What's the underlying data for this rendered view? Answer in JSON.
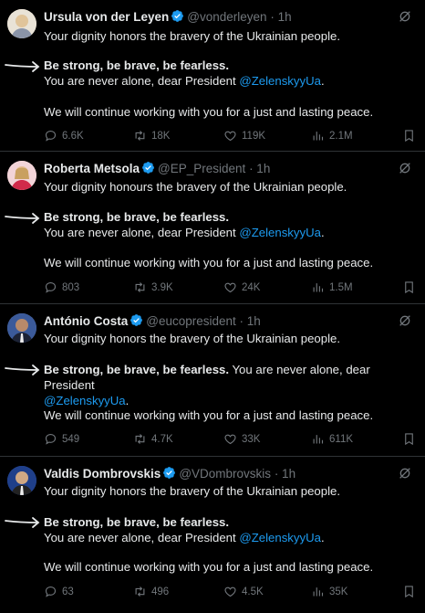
{
  "tweets": [
    {
      "name": "Ursula von der Leyen",
      "handle": "@vonderleyen",
      "time": "· 1h",
      "line1": "Your dignity honors the bravery of the Ukrainian people.",
      "bold": "Be strong, be brave, be fearless.",
      "line3a": "You are never alone, dear President ",
      "mention": "@ZelenskyyUa",
      "line3b": ".",
      "line4": "We will continue working with you for a just and lasting peace.",
      "replies": "6.6K",
      "reposts": "18K",
      "likes": "119K",
      "views": "2.1M",
      "avatar_color": "#c9b8a0"
    },
    {
      "name": "Roberta Metsola",
      "handle": "@EP_President",
      "time": "· 1h",
      "line1": "Your dignity honours the bravery of the Ukrainian people.",
      "bold": "Be strong, be brave, be fearless.",
      "line3a": "You are never alone, dear President ",
      "mention": "@ZelenskyyUa",
      "line3b": ".",
      "line4": "We will continue working with you for a just and lasting peace.",
      "replies": "803",
      "reposts": "3.9K",
      "likes": "24K",
      "views": "1.5M",
      "avatar_color": "#d9a0a8"
    },
    {
      "name": "António Costa",
      "handle": "@eucopresident",
      "time": "· 1h",
      "line1": "Your dignity honors the bravery of the Ukrainian people.",
      "bold": "Be strong, be brave, be fearless.",
      "line3a": " You are never alone, dear President",
      "mention": "@ZelenskyyUa",
      "line3b": ".",
      "line4": "We will continue working with you for a just and lasting peace.",
      "replies": "549",
      "reposts": "4.7K",
      "likes": "33K",
      "views": "611K",
      "avatar_color": "#6a7fa8"
    },
    {
      "name": "Valdis Dombrovskis",
      "handle": "@VDombrovskis",
      "time": "· 1h",
      "line1": "Your dignity honors the bravery of the Ukrainian people.",
      "bold": "Be strong, be brave, be fearless.",
      "line3a": "You are never alone, dear President ",
      "mention": "@ZelenskyyUa",
      "line3b": ".",
      "line4": "We will continue working with you for a just and lasting peace.",
      "replies": "63",
      "reposts": "496",
      "likes": "4.5K",
      "views": "35K",
      "avatar_color": "#2f4f8a"
    }
  ],
  "colors": {
    "text": "#e7e9ea",
    "muted": "#71767b",
    "link": "#1d9bf0",
    "verified": "#1d9bf0"
  }
}
